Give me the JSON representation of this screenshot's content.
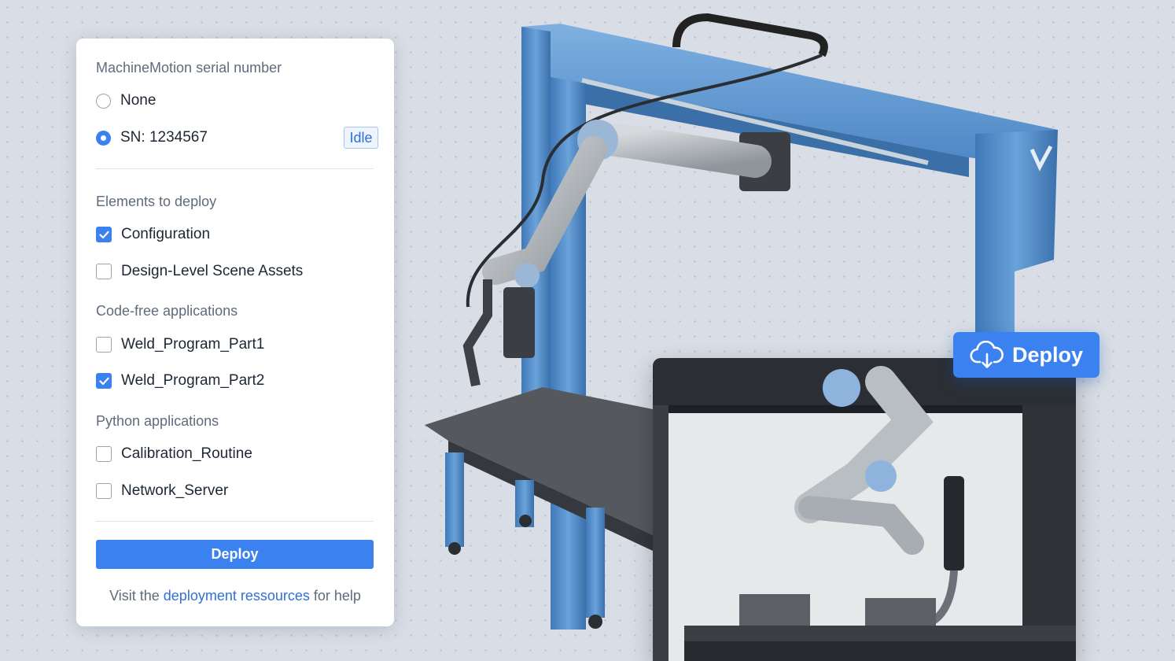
{
  "panel": {
    "serial_title": "MachineMotion serial number",
    "serial_options": [
      {
        "label": "None",
        "selected": false
      },
      {
        "label": "SN: 1234567",
        "selected": true,
        "status": "Idle"
      }
    ],
    "sections": [
      {
        "title": "Elements to deploy",
        "items": [
          {
            "label": "Configuration",
            "checked": true
          },
          {
            "label": "Design-Level Scene Assets",
            "checked": false
          }
        ]
      },
      {
        "title": "Code-free applications",
        "items": [
          {
            "label": "Weld_Program_Part1",
            "checked": false
          },
          {
            "label": "Weld_Program_Part2",
            "checked": true
          }
        ]
      },
      {
        "title": "Python applications",
        "items": [
          {
            "label": "Calibration_Routine",
            "checked": false
          },
          {
            "label": "Network_Server",
            "checked": false
          }
        ]
      }
    ],
    "deploy_label": "Deploy",
    "help_prefix": "Visit the ",
    "help_link": "deployment ressources",
    "help_suffix": " for help"
  },
  "floating_button": {
    "label": "Deploy",
    "icon": "cloud-download-icon"
  },
  "colors": {
    "accent": "#3b82f0",
    "frame_blue": "#4f8bc9",
    "background": "#d9dee6"
  }
}
